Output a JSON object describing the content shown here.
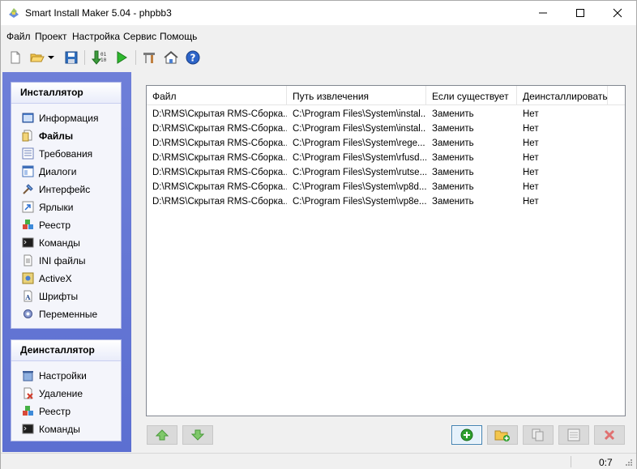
{
  "window": {
    "title": "Smart Install Maker 5.04 - phpbb3"
  },
  "menu": [
    "Файл",
    "Проект",
    "Настройка",
    "Сервис",
    "Помощь"
  ],
  "toolbar": [
    "new-file-icon",
    "open-folder-icon",
    "dropdown-arrow-icon",
    "save-icon",
    "build-icon",
    "run-icon",
    "tools-icon",
    "home-icon",
    "help-icon"
  ],
  "sidebar": {
    "installer": {
      "title": "Инсталлятор",
      "items": [
        "Информация",
        "Файлы",
        "Требования",
        "Диалоги",
        "Интерфейс",
        "Ярлыки",
        "Реестр",
        "Команды",
        "INI файлы",
        "ActiveX",
        "Шрифты",
        "Переменные"
      ],
      "active": "Файлы"
    },
    "uninstaller": {
      "title": "Деинсталлятор",
      "items": [
        "Настройки",
        "Удаление",
        "Реестр",
        "Команды"
      ]
    }
  },
  "files": {
    "columns": [
      "Файл",
      "Путь извлечения",
      "Если существует",
      "Деинсталлировать"
    ],
    "rows": [
      [
        "D:\\RMS\\Скрытая RMS-Сборка...",
        "C:\\Program Files\\System\\instal...",
        "Заменить",
        "Нет"
      ],
      [
        "D:\\RMS\\Скрытая RMS-Сборка...",
        "C:\\Program Files\\System\\instal...",
        "Заменить",
        "Нет"
      ],
      [
        "D:\\RMS\\Скрытая RMS-Сборка...",
        "C:\\Program Files\\System\\rege...",
        "Заменить",
        "Нет"
      ],
      [
        "D:\\RMS\\Скрытая RMS-Сборка...",
        "C:\\Program Files\\System\\rfusd...",
        "Заменить",
        "Нет"
      ],
      [
        "D:\\RMS\\Скрытая RMS-Сборка...",
        "C:\\Program Files\\System\\rutse...",
        "Заменить",
        "Нет"
      ],
      [
        "D:\\RMS\\Скрытая RMS-Сборка...",
        "C:\\Program Files\\System\\vp8d...",
        "Заменить",
        "Нет"
      ],
      [
        "D:\\RMS\\Скрытая RMS-Сборка...",
        "C:\\Program Files\\System\\vp8e...",
        "Заменить",
        "Нет"
      ]
    ]
  },
  "bottom_buttons": [
    "move-up-icon",
    "move-down-icon",
    "add-file-icon",
    "add-folder-icon",
    "copy-icon",
    "properties-icon",
    "delete-icon"
  ],
  "status": {
    "time": "0:7"
  }
}
